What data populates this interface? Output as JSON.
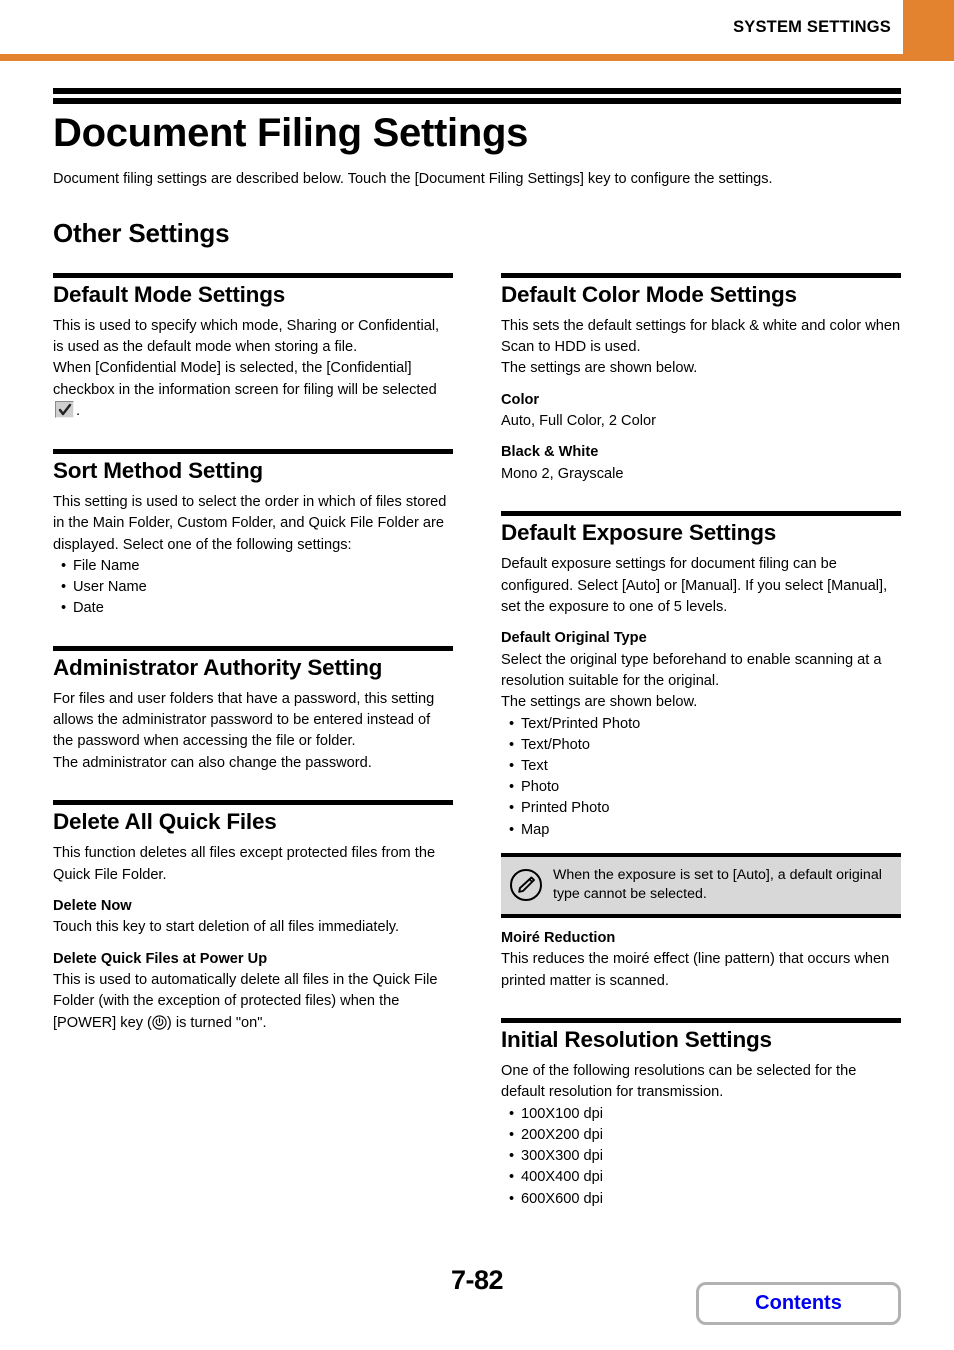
{
  "header": {
    "title": "SYSTEM SETTINGS",
    "accent_color": "#e3832f"
  },
  "document": {
    "title": "Document Filing Settings",
    "intro": "Document filing settings are described below. Touch the [Document Filing Settings] key to configure the settings.",
    "section_title": "Other Settings"
  },
  "left_column": {
    "default_mode": {
      "heading": "Default Mode Settings",
      "para1": "This is used to specify which mode, Sharing or Confidential, is used as the default mode when storing a file.",
      "para2_before": "When [Confidential Mode] is selected, the [Confidential] checkbox in the information screen for filing will be selected",
      "para2_after": "."
    },
    "sort_method": {
      "heading": "Sort Method Setting",
      "para1": "This setting is used to select the order in which of files stored in the Main Folder, Custom Folder, and Quick File Folder are displayed. Select one of the following settings:",
      "bullets": [
        "File Name",
        "User Name",
        "Date"
      ]
    },
    "admin_authority": {
      "heading": "Administrator Authority Setting",
      "para1": "For files and user folders that have a password, this setting allows the administrator password to be entered instead of the password when accessing the file or folder.",
      "para2": "The administrator can also change the password."
    },
    "delete_all_quick_files": {
      "heading": "Delete All Quick Files",
      "para1": "This function deletes all files except protected files from the Quick File Folder.",
      "sub1_title": "Delete Now",
      "sub1_text": "Touch this key to start deletion of all files immediately.",
      "sub2_title": "Delete Quick Files at Power Up",
      "sub2_text_before": "This is used to automatically delete all files in the Quick File Folder (with the exception of protected files) when the [POWER] key (",
      "sub2_text_after": ") is turned \"on\"."
    }
  },
  "right_column": {
    "default_color_mode": {
      "heading": "Default Color Mode Settings",
      "para1": "This sets the default settings for black & white and color when Scan to HDD is used.",
      "para2": "The settings are shown below.",
      "sub1_title": "Color",
      "sub1_text": "Auto, Full Color, 2 Color",
      "sub2_title": "Black & White",
      "sub2_text": "Mono 2, Grayscale"
    },
    "default_exposure": {
      "heading": "Default Exposure Settings",
      "para1": "Default exposure settings for document filing can be configured. Select [Auto] or [Manual]. If you select [Manual], set the exposure to one of 5 levels.",
      "sub1_title": "Default Original Type",
      "sub1_text": "Select the original type beforehand to enable scanning at a resolution suitable for the original.",
      "sub1_text2": "The settings are shown below.",
      "bullets": [
        "Text/Printed Photo",
        "Text/Photo",
        "Text",
        "Photo",
        "Printed Photo",
        "Map"
      ],
      "note": "When the exposure is set to [Auto], a default original type cannot be selected.",
      "sub2_title": "Moiré Reduction",
      "sub2_text": "This reduces the moiré effect (line pattern) that occurs when printed matter is scanned."
    },
    "initial_resolution": {
      "heading": "Initial Resolution Settings",
      "para1": "One of the following resolutions can be selected for the default resolution for transmission.",
      "bullets": [
        "100X100 dpi",
        "200X200 dpi",
        "300X300 dpi",
        "400X400 dpi",
        "600X600 dpi"
      ]
    }
  },
  "footer": {
    "page_number": "7-82",
    "contents_label": "Contents",
    "contents_color": "#0000f0"
  }
}
